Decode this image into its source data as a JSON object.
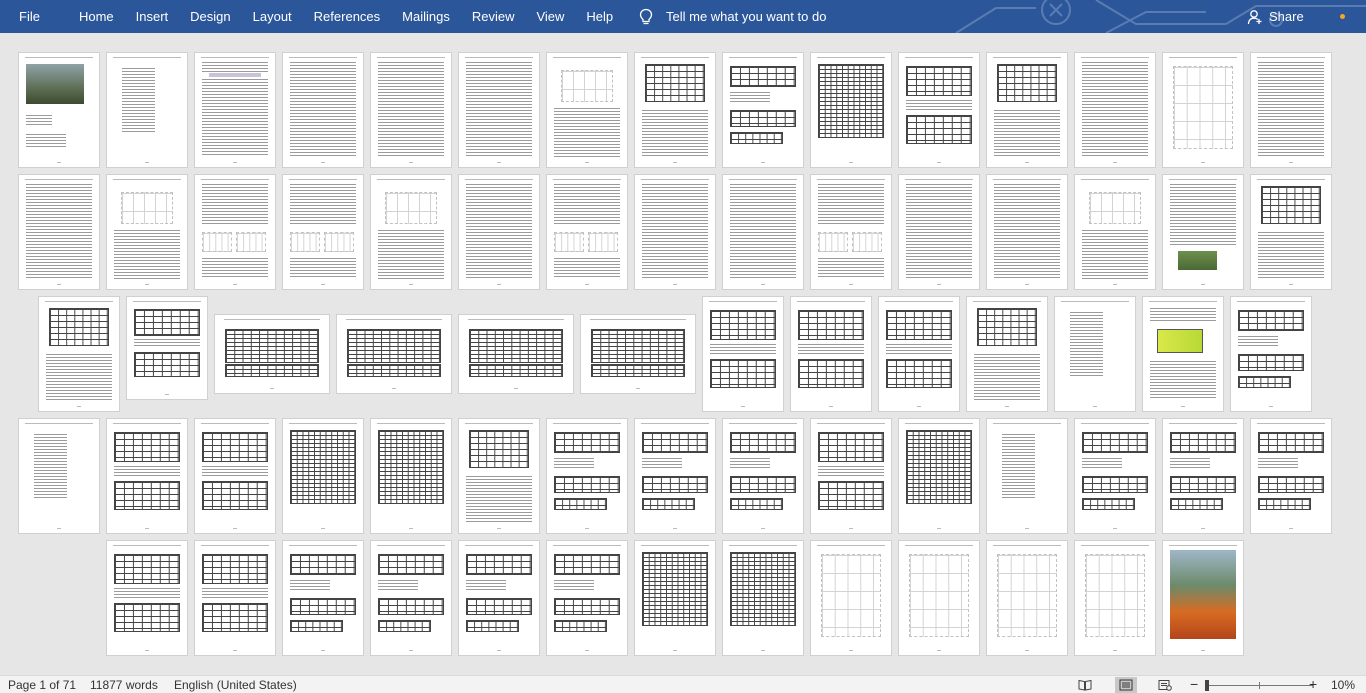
{
  "ribbon": {
    "tabs": [
      "File",
      "Home",
      "Insert",
      "Design",
      "Layout",
      "References",
      "Mailings",
      "Review",
      "View",
      "Help"
    ],
    "tell_me": "Tell me what you want to do",
    "share": "Share",
    "accent": "#2b579a",
    "icons": {
      "tell_me": "lightbulb-icon",
      "share": "person-icon"
    }
  },
  "status": {
    "page": "Page 1 of 71",
    "words": "11877 words",
    "language": "English (United States)",
    "zoom_minus": "−",
    "zoom_plus": "+",
    "zoom": "10%",
    "icons": [
      "read-mode-icon",
      "print-layout-icon",
      "web-layout-icon"
    ]
  }
}
